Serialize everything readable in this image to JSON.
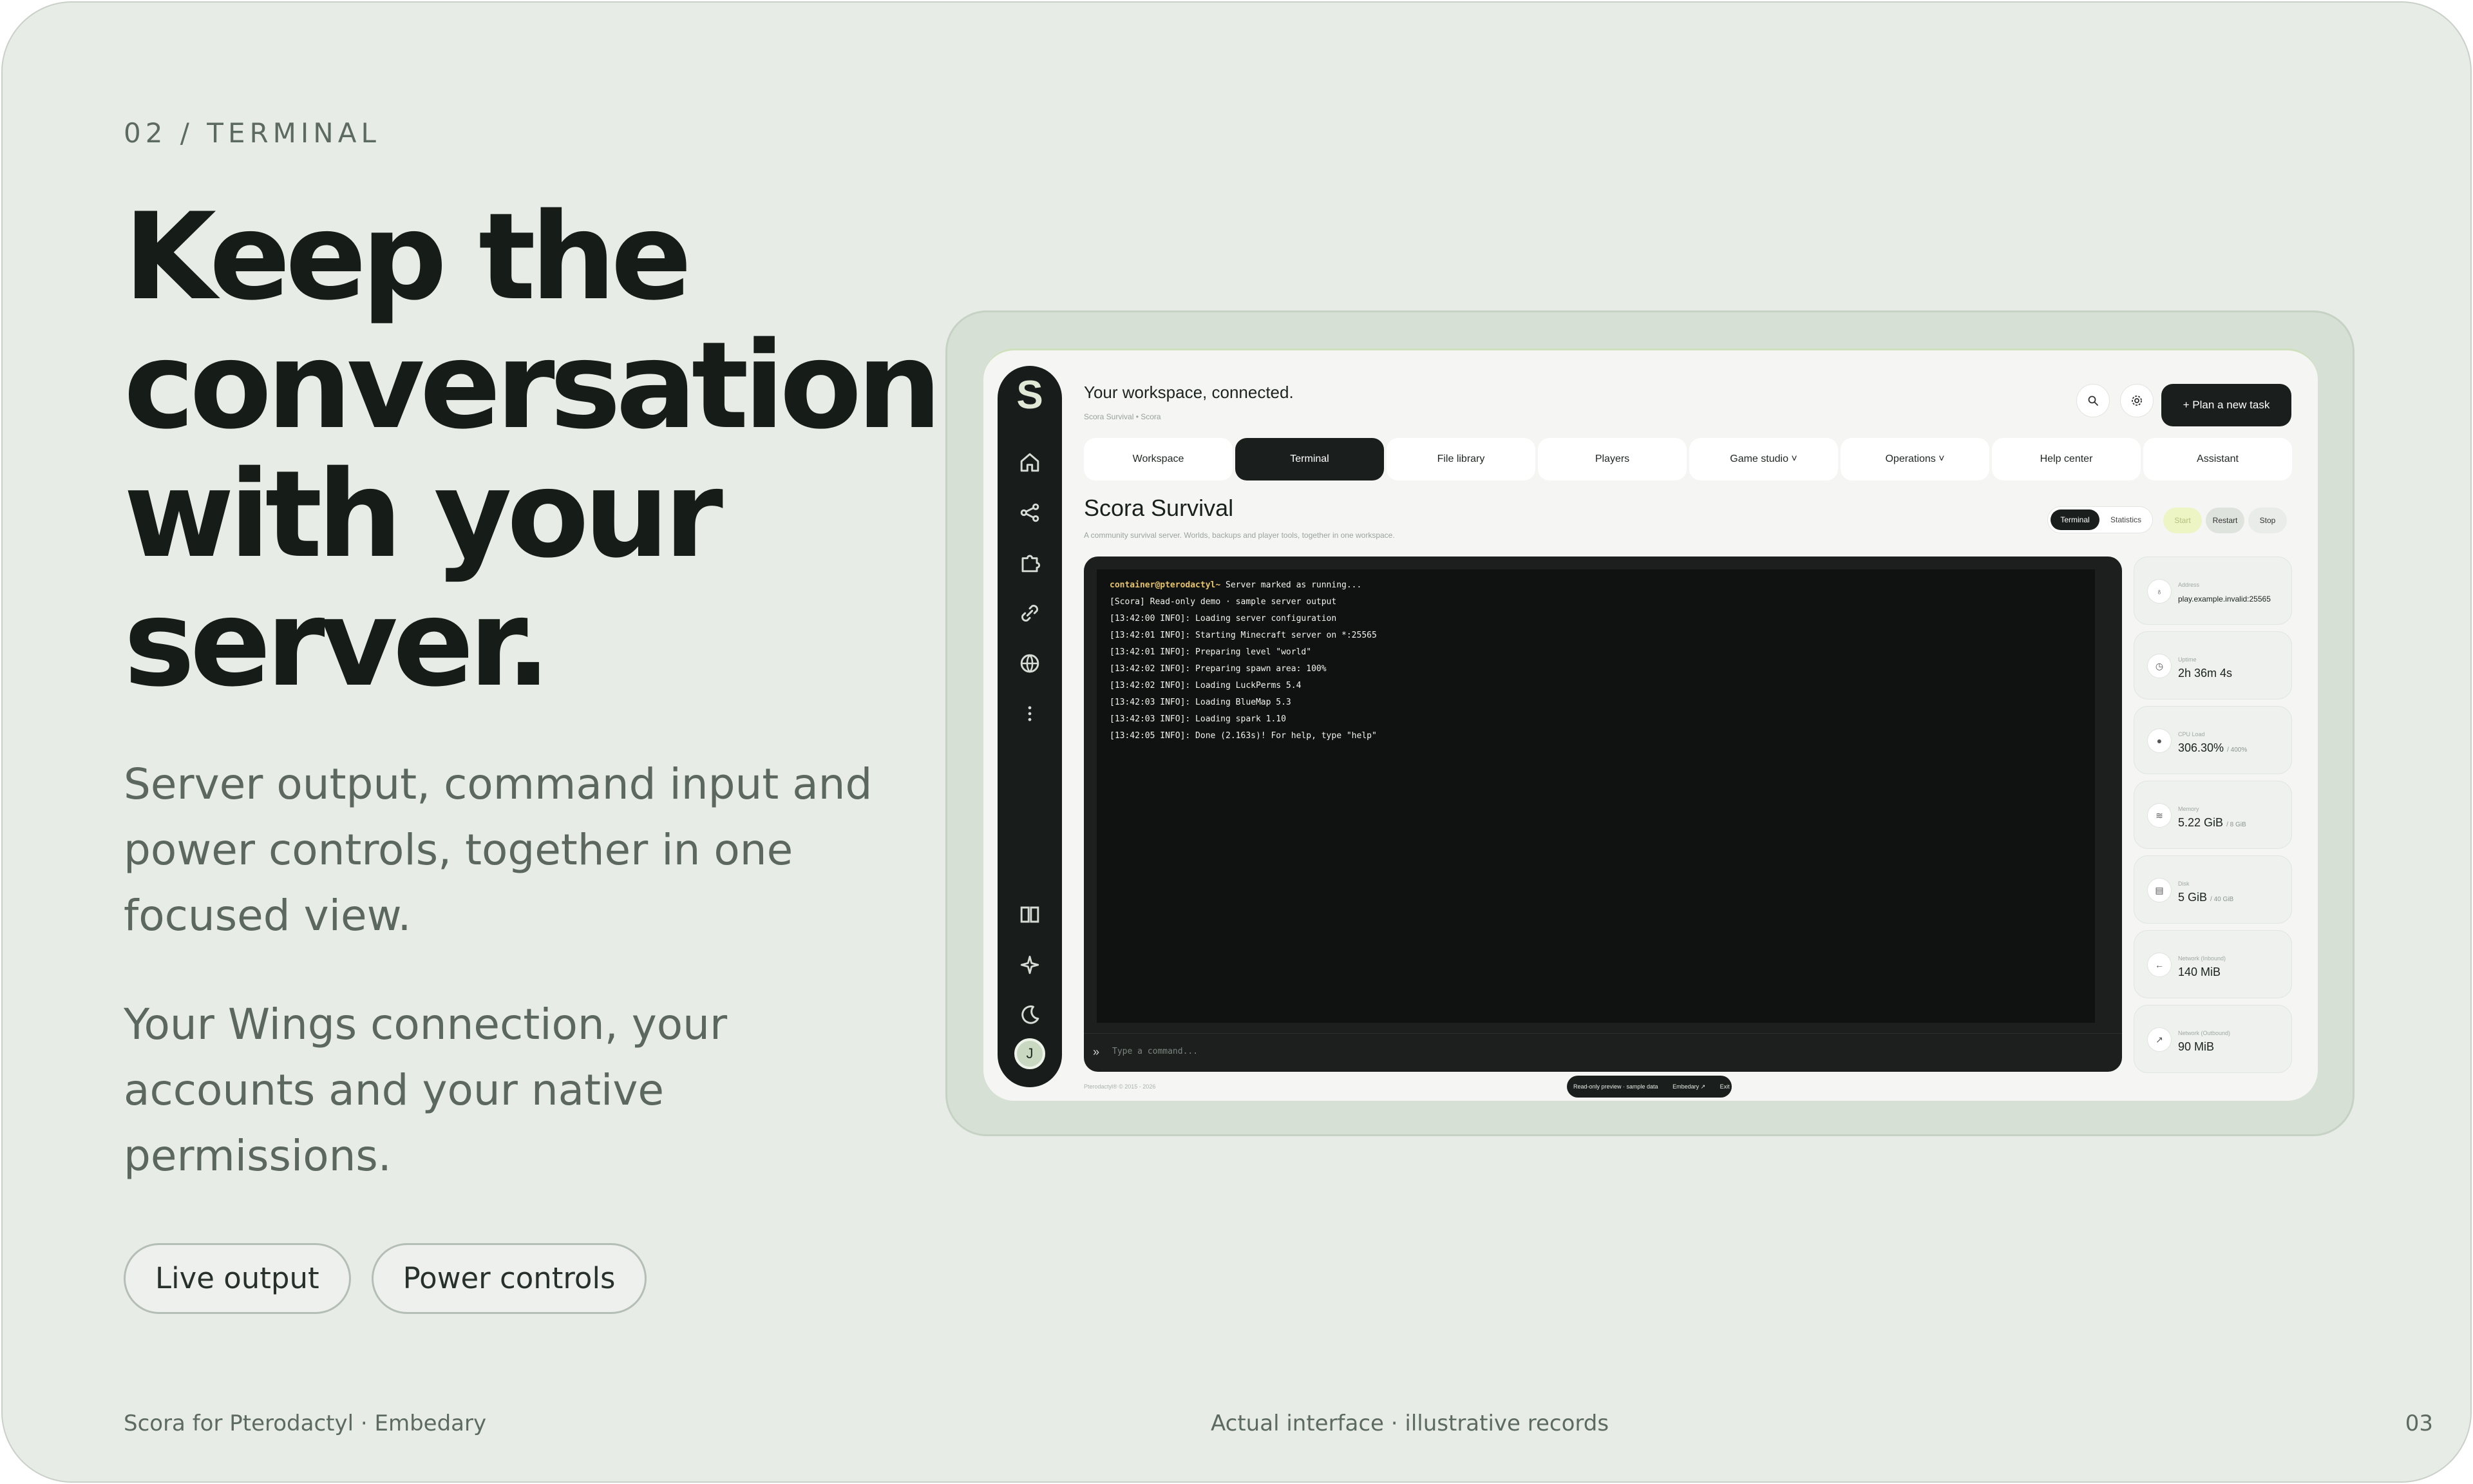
{
  "eyebrow": "02 / TERMINAL",
  "hero": {
    "title_lines": [
      "Keep the",
      "conversation",
      "with your",
      "server."
    ],
    "paragraph1": "Server output, command input and power controls, together in one focused view.",
    "paragraph2": "Your Wings connection, your accounts and your native permissions."
  },
  "chips": [
    "Live output",
    "Power controls"
  ],
  "footer": {
    "left": "Scora for Pterodactyl · Embedary",
    "center": "Actual interface · illustrative records",
    "page": "03"
  },
  "app": {
    "logo": "S",
    "rail_icons": [
      "home-icon",
      "share-icon",
      "puzzle-icon",
      "link-icon",
      "globe-icon",
      "more-icon",
      "book-icon",
      "sparkle-icon",
      "moon-icon"
    ],
    "avatar_initial": "J",
    "workspace_title": "Your workspace, connected.",
    "breadcrumb": "Scora Survival  •  Scora",
    "plan_button": "+  Plan a new task",
    "tabs": [
      "Workspace",
      "Terminal",
      "File library",
      "Players",
      "Game studio ˅",
      "Operations ˅",
      "Help center",
      "Assistant"
    ],
    "active_tab": "Terminal",
    "server_title": "Scora Survival",
    "server_subtitle": "A community survival server. Worlds, backups and player tools, together in one workspace.",
    "segment": [
      "Terminal",
      "Statistics"
    ],
    "power": [
      "Start",
      "Restart",
      "Stop"
    ],
    "terminal": {
      "prompt": "container@pterodactyl~",
      "prompt_rest": " Server marked as running...",
      "lines": [
        "[Scora] Read-only demo · sample server output",
        "[13:42:00 INFO]: Loading server configuration",
        "[13:42:01 INFO]: Starting Minecraft server on *:25565",
        "[13:42:01 INFO]: Preparing level \"world\"",
        "[13:42:02 INFO]: Preparing spawn area: 100%",
        "[13:42:02 INFO]: Loading LuckPerms 5.4",
        "[13:42:03 INFO]: Loading BlueMap 5.3",
        "[13:42:03 INFO]: Loading spark 1.10",
        "[13:42:05 INFO]: Done (2.163s)! For help, type \"help\""
      ],
      "input_placeholder": "Type a command..."
    },
    "stats": [
      {
        "label": "Address",
        "value": "play.example.invalid:25565",
        "max": ""
      },
      {
        "label": "Uptime",
        "value": "2h 36m 4s",
        "max": ""
      },
      {
        "label": "CPU Load",
        "value": "306.30%",
        "max": "/ 400%"
      },
      {
        "label": "Memory",
        "value": "5.22 GiB",
        "max": "/ 8 GiB"
      },
      {
        "label": "Disk",
        "value": "5 GiB",
        "max": "/ 40 GiB"
      },
      {
        "label": "Network (Inbound)",
        "value": "140 MiB",
        "max": ""
      },
      {
        "label": "Network (Outbound)",
        "value": "90 MiB",
        "max": ""
      }
    ],
    "footer_note": "Pterodactyl® © 2015 - 2026",
    "demo_pill": [
      "Read-only preview · sample data",
      "Embedary ↗",
      "Exit"
    ]
  },
  "colors": {
    "background": "#e8ece7",
    "dark": "#1a1e1c",
    "start_button": "#eef5c4",
    "prompt": "#e7c46a"
  }
}
